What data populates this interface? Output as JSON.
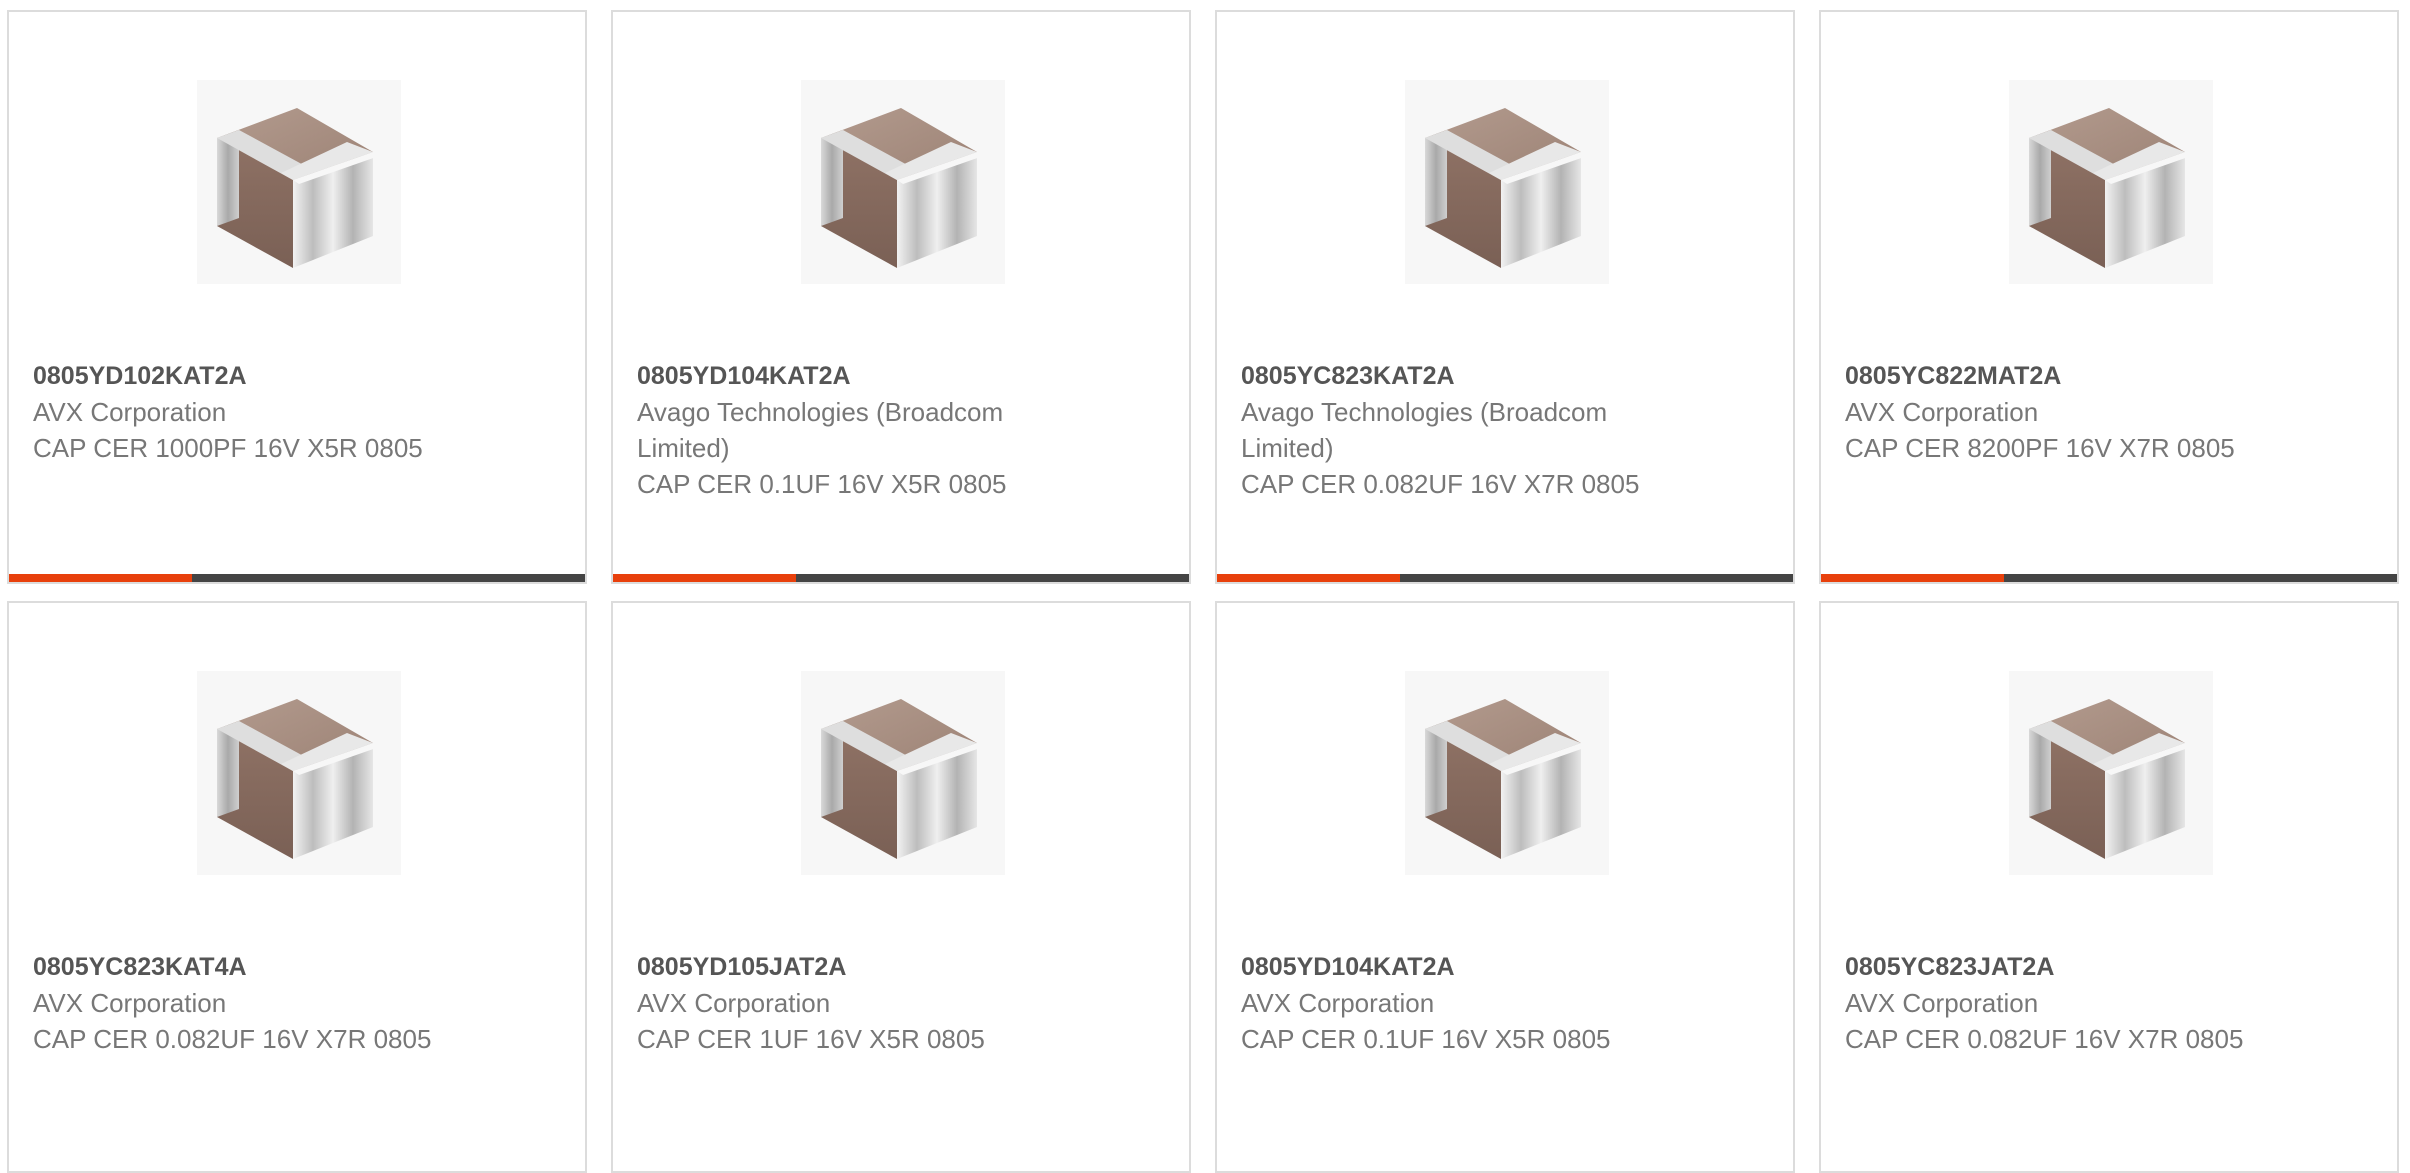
{
  "accent_color": "#e8400c",
  "bar_color": "#444444",
  "products": [
    {
      "part_number": "0805YD102KAT2A",
      "manufacturer": "AVX Corporation",
      "description": "CAP CER 1000PF 16V X5R 0805",
      "image": "ceramic-capacitor-icon"
    },
    {
      "part_number": "0805YD104KAT2A",
      "manufacturer": "Avago Technologies (Broadcom Limited)",
      "description": "CAP CER 0.1UF 16V X5R 0805",
      "image": "ceramic-capacitor-icon"
    },
    {
      "part_number": "0805YC823KAT2A",
      "manufacturer": "Avago Technologies (Broadcom Limited)",
      "description": "CAP CER 0.082UF 16V X7R 0805",
      "image": "ceramic-capacitor-icon"
    },
    {
      "part_number": "0805YC822MAT2A",
      "manufacturer": "AVX Corporation",
      "description": "CAP CER 8200PF 16V X7R 0805",
      "image": "ceramic-capacitor-icon"
    },
    {
      "part_number": "0805YC823KAT4A",
      "manufacturer": "AVX Corporation",
      "description": "CAP CER 0.082UF 16V X7R 0805",
      "image": "ceramic-capacitor-icon"
    },
    {
      "part_number": "0805YD105JAT2A",
      "manufacturer": "AVX Corporation",
      "description": "CAP CER 1UF 16V X5R 0805",
      "image": "ceramic-capacitor-icon"
    },
    {
      "part_number": "0805YD104KAT2A",
      "manufacturer": "AVX Corporation",
      "description": "CAP CER 0.1UF 16V X5R 0805",
      "image": "ceramic-capacitor-icon"
    },
    {
      "part_number": "0805YC823JAT2A",
      "manufacturer": "AVX Corporation",
      "description": "CAP CER 0.082UF 16V X7R 0805",
      "image": "ceramic-capacitor-icon"
    }
  ]
}
